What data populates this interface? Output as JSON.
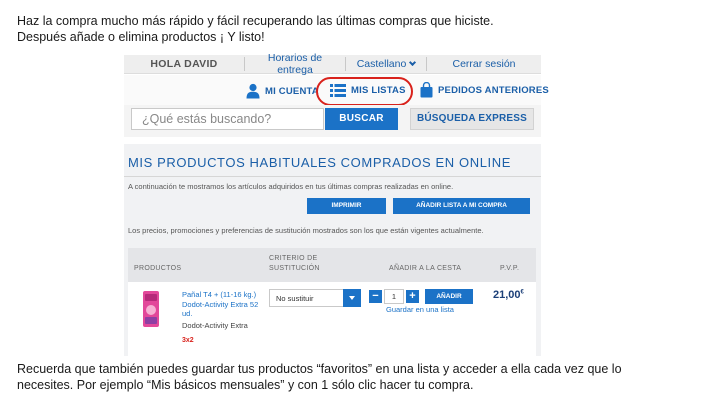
{
  "intro": {
    "line1": "Haz la compra mucho más rápido y fácil recuperando las últimas compras que hiciste.",
    "line2": "Después añade o elimina productos ¡ Y listo!"
  },
  "header": {
    "greeting": "HOLA DAVID",
    "delivery_hours": "Horarios de entrega",
    "language": "Castellano",
    "logout": "Cerrar sesión"
  },
  "nav": {
    "account": "MI CUENTA",
    "lists": "MIS LISTAS",
    "orders": "PEDIDOS ANTERIORES"
  },
  "search": {
    "placeholder": "¿Qué estás buscando?",
    "button": "BUSCAR",
    "express": "BÚSQUEDA EXPRESS"
  },
  "panel": {
    "title": "MIS PRODUCTOS HABITUALES COMPRADOS EN ONLINE",
    "description": "A continuación te mostramos los artículos adquiridos en tus últimas compras realizadas en online.",
    "print_button": "IMPRIMIR",
    "add_to_list_button": "AÑADIR LISTA A MI COMPRA",
    "note": "Los precios, promociones y preferencias de sustitución mostrados son los que están vigentes actualmente."
  },
  "table": {
    "headers": {
      "products": "PRODUCTOS",
      "criteria_line1": "CRITERIO DE",
      "criteria_line2": "SUSTITUCIÓN",
      "add_to_cart": "AÑADIR A LA CESTA",
      "pvp": "P.V.P."
    },
    "rows": [
      {
        "name": "Pañal T4 + (11-16 kg.) Dodot-Activity Extra 52 ud.",
        "brand": "Dodot-Activity Extra",
        "promo": "3x2",
        "substitution": "No sustituir",
        "quantity": "1",
        "add_button": "AÑADIR",
        "save_link": "Guardar en una lista",
        "price_main": "21,00",
        "price_currency": "€"
      }
    ]
  },
  "outro": {
    "line1": "Recuerda que también puedes guardar tus productos “favoritos” en una lista y acceder a ella cada vez que lo",
    "line2": "necesites. Por ejemplo “Mis básicos mensuales” y con 1 sólo clic hacer tu compra."
  },
  "colors": {
    "accent": "#1b72c7",
    "link": "#1b5fa8",
    "highlight": "#d9221c"
  }
}
